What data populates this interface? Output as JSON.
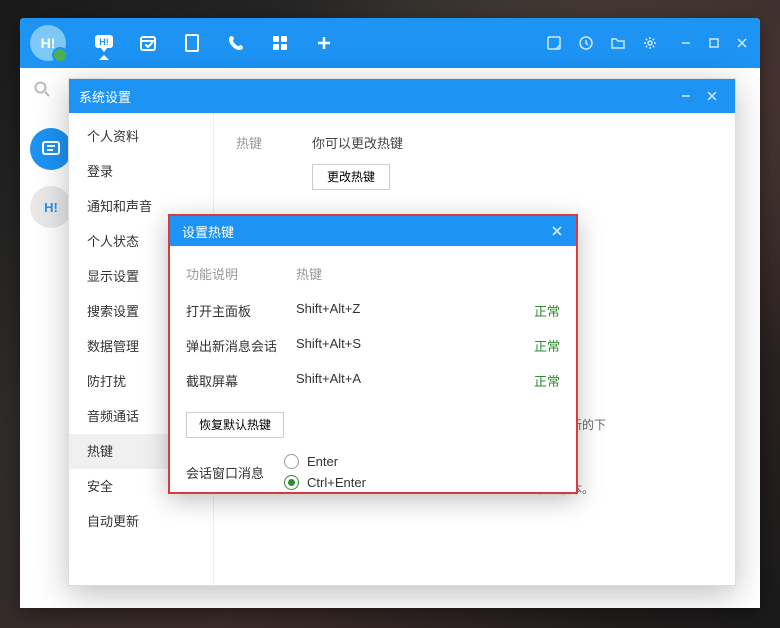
{
  "titlebar": {
    "avatar_label": "H!"
  },
  "settings": {
    "title": "系统设置",
    "nav": [
      "个人资料",
      "登录",
      "通知和声音",
      "个人状态",
      "显示设置",
      "搜索设置",
      "数据管理",
      "防打扰",
      "音频通话",
      "热键",
      "安全",
      "自动更新"
    ],
    "active_index": 9,
    "section_label": "热键",
    "desc": "你可以更改热键",
    "change_btn": "更改热键",
    "update_text1": "完成更新的下",
    "update_text2": "最新版本。"
  },
  "hotkey": {
    "title": "设置热键",
    "header_func": "功能说明",
    "header_key": "热键",
    "rows": [
      {
        "func": "打开主面板",
        "key": "Shift+Alt+Z",
        "status": "正常"
      },
      {
        "func": "弹出新消息会话",
        "key": "Shift+Alt+S",
        "status": "正常"
      },
      {
        "func": "截取屏幕",
        "key": "Shift+Alt+A",
        "status": "正常"
      }
    ],
    "restore_btn": "恢复默认热键",
    "send_label": "会话窗口消息",
    "radio_enter": "Enter",
    "radio_ctrl_enter": "Ctrl+Enter",
    "selected_radio": 1
  }
}
